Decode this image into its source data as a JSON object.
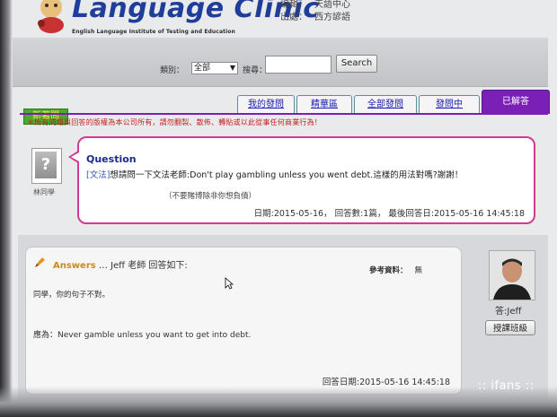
{
  "header": {
    "logo_title": "Language Clinic",
    "logo_subtitle": "English Language Institute of Testing and Education",
    "meta_row1_label": "編輯：",
    "meta_row1_value": "天語中心",
    "meta_row2_label": "出處：",
    "meta_row2_value": "西方諺語"
  },
  "search": {
    "category_label": "類別：",
    "category_value": "全部",
    "keyword_label": "搜尋：",
    "keyword_value": "",
    "button_label": "Search"
  },
  "tabs": {
    "new_question": "新著問",
    "items": [
      {
        "label": "我的發問"
      },
      {
        "label": "精華區"
      },
      {
        "label": "全部發問"
      },
      {
        "label": "發問中"
      },
      {
        "label": "已解答"
      }
    ],
    "active_index": 4
  },
  "notice": "＊所有問題與回答的版權為本公司所有，請勿翻製、散佈、轉貼或以此從事任何商業行為！",
  "question": {
    "user_name": "林同學",
    "title": "Question",
    "tag": "[文法]",
    "text": "想請問一下文法老師:Don't play gambling unless you went debt.這樣的用法對嗎?謝謝！",
    "note": "（不要賭博除非你想負債）",
    "date_label": "日期:",
    "date": "2015-05-16",
    "reply_count_label": "回答數:",
    "reply_count": "1篇",
    "last_reply_label": "最後回答日:",
    "last_reply": "2015-05-16 14:45:18"
  },
  "answer": {
    "heading": "Answers",
    "teacher_line": "… Jeff 老師 回答如下:",
    "reference_label": "參考資料：",
    "reference_value": "無",
    "line1": "同學，你的句子不對。",
    "line2": "應為：Never gamble unless you want to get into debt.",
    "date_label": "回答日期:",
    "date": "2015-05-16 14:45:18",
    "teacher_name": "答:Jeff",
    "class_button": "授課班級"
  },
  "watermark": ":: ifans ::"
}
